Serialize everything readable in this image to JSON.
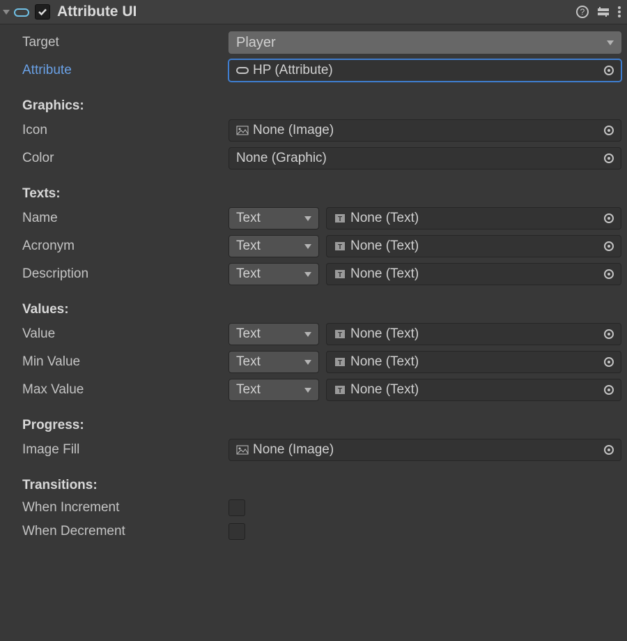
{
  "header": {
    "title": "Attribute UI",
    "enabled": true
  },
  "fields": {
    "target": {
      "label": "Target",
      "value": "Player"
    },
    "attribute": {
      "label": "Attribute",
      "value": "HP (Attribute)"
    }
  },
  "sections": {
    "graphics": {
      "title": "Graphics:",
      "icon": {
        "label": "Icon",
        "value": "None (Image)"
      },
      "color": {
        "label": "Color",
        "value": "None (Graphic)"
      }
    },
    "texts": {
      "title": "Texts:",
      "name": {
        "label": "Name",
        "type": "Text",
        "value": "None (Text)"
      },
      "acronym": {
        "label": "Acronym",
        "type": "Text",
        "value": "None (Text)"
      },
      "description": {
        "label": "Description",
        "type": "Text",
        "value": "None (Text)"
      }
    },
    "values": {
      "title": "Values:",
      "value": {
        "label": "Value",
        "type": "Text",
        "value": "None (Text)"
      },
      "minValue": {
        "label": "Min Value",
        "type": "Text",
        "value": "None (Text)"
      },
      "maxValue": {
        "label": "Max Value",
        "type": "Text",
        "value": "None (Text)"
      }
    },
    "progress": {
      "title": "Progress:",
      "imageFill": {
        "label": "Image Fill",
        "value": "None (Image)"
      }
    },
    "transitions": {
      "title": "Transitions:",
      "whenIncrement": {
        "label": "When Increment",
        "value": false
      },
      "whenDecrement": {
        "label": "When Decrement",
        "value": false
      }
    }
  }
}
